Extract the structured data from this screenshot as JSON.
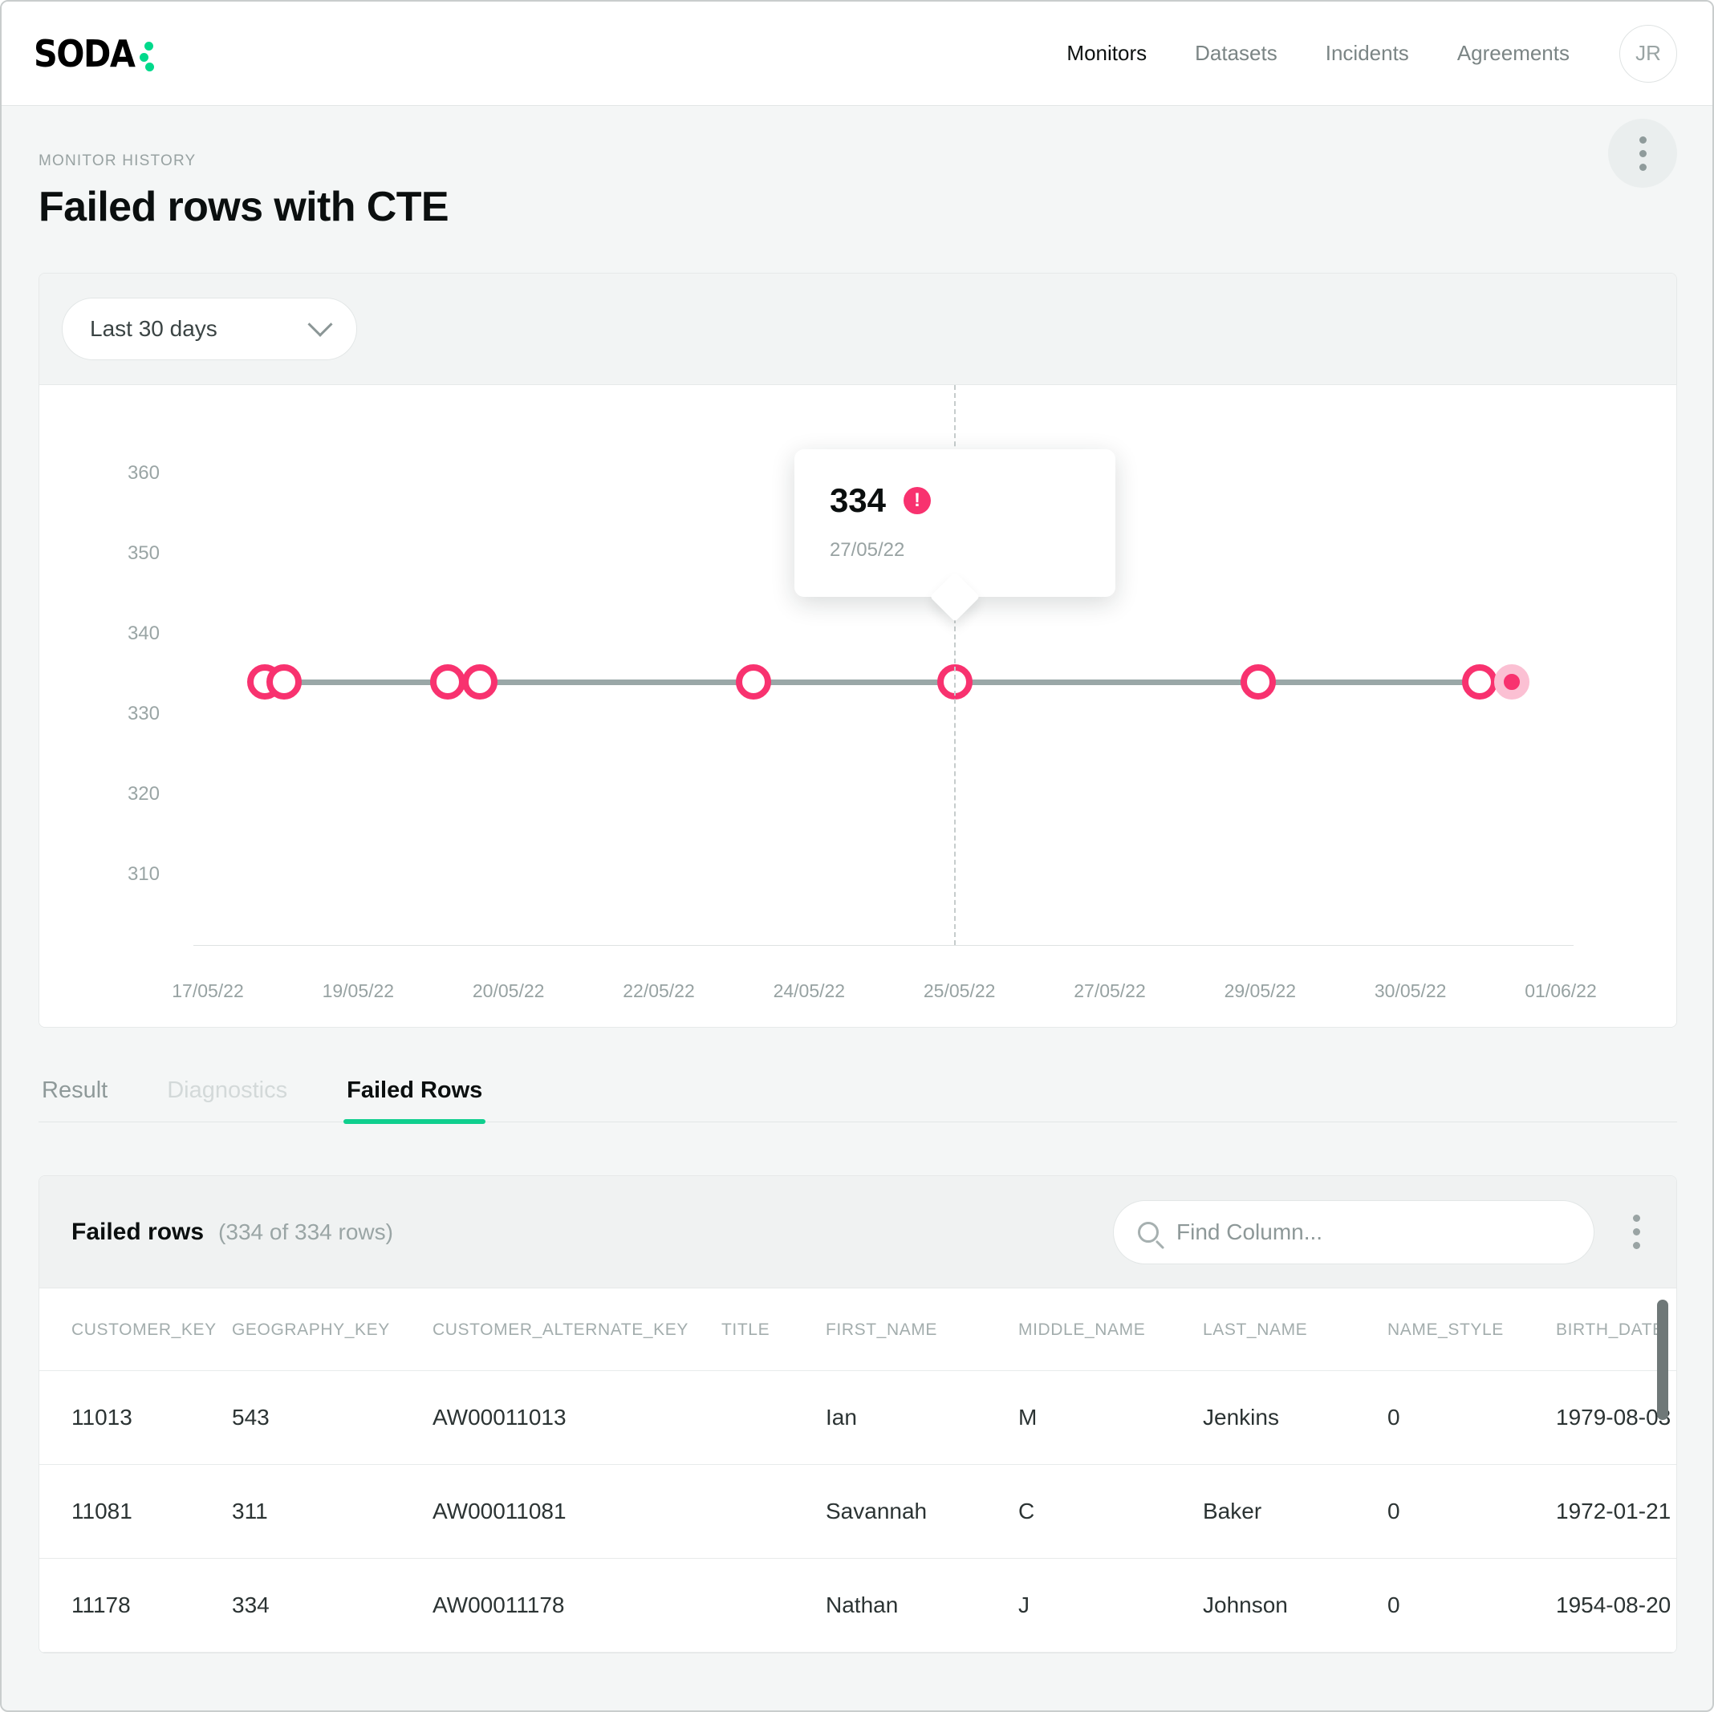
{
  "nav": {
    "logo_text": "SODA",
    "links": [
      {
        "label": "Monitors",
        "active": true
      },
      {
        "label": "Datasets",
        "active": false
      },
      {
        "label": "Incidents",
        "active": false
      },
      {
        "label": "Agreements",
        "active": false
      }
    ],
    "avatar_initials": "JR"
  },
  "page": {
    "eyebrow": "MONITOR HISTORY",
    "title": "Failed rows with CTE"
  },
  "chart_card": {
    "range_label": "Last 30 days"
  },
  "chart_data": {
    "type": "line",
    "title": "",
    "xlabel": "",
    "ylabel": "",
    "ylim": [
      305,
      365
    ],
    "yticks": [
      360,
      350,
      340,
      330,
      320,
      310
    ],
    "xticks": [
      "17/05/22",
      "19/05/22",
      "20/05/22",
      "22/05/22",
      "24/05/22",
      "25/05/22",
      "27/05/22",
      "29/05/22",
      "30/05/22",
      "01/06/22"
    ],
    "grid": false,
    "legend": "none",
    "series": [
      {
        "name": "Failed rows",
        "color": "#f8326f",
        "line_color": "#9aa7a7",
        "points": [
          {
            "x": "17/05/22",
            "y": 334,
            "style": "ring"
          },
          {
            "x": "18/05/22",
            "y": 334,
            "style": "ring"
          },
          {
            "x": "19/05/22",
            "y": 334,
            "style": "ring"
          },
          {
            "x": "20/05/22",
            "y": 334,
            "style": "ring"
          },
          {
            "x": "24/05/22",
            "y": 334,
            "style": "ring"
          },
          {
            "x": "27/05/22",
            "y": 334,
            "style": "ring"
          },
          {
            "x": "30/05/22",
            "y": 334,
            "style": "ring"
          },
          {
            "x": "01/06/22",
            "y": 334,
            "style": "ring"
          },
          {
            "x": "02/06/22",
            "y": 334,
            "style": "filled"
          }
        ]
      }
    ],
    "tooltip": {
      "value": "334",
      "badge": "!",
      "date": "27/05/22"
    }
  },
  "tabs": [
    {
      "label": "Result",
      "state": "normal"
    },
    {
      "label": "Diagnostics",
      "state": "disabled"
    },
    {
      "label": "Failed Rows",
      "state": "active"
    }
  ],
  "table": {
    "title": "Failed rows",
    "count_label": "(334 of 334 rows)",
    "search_placeholder": "Find Column...",
    "columns": [
      "CUSTOMER_KEY",
      "GEOGRAPHY_KEY",
      "CUSTOMER_ALTERNATE_KEY",
      "TITLE",
      "FIRST_NAME",
      "MIDDLE_NAME",
      "LAST_NAME",
      "NAME_STYLE",
      "BIRTH_DATE"
    ],
    "rows": [
      [
        "11013",
        "543",
        "AW00011013",
        "",
        "Ian",
        "M",
        "Jenkins",
        "0",
        "1979-08-03"
      ],
      [
        "11081",
        "311",
        "AW00011081",
        "",
        "Savannah",
        "C",
        "Baker",
        "0",
        "1972-01-21"
      ],
      [
        "11178",
        "334",
        "AW00011178",
        "",
        "Nathan",
        "J",
        "Johnson",
        "0",
        "1954-08-20"
      ]
    ]
  },
  "colors": {
    "accent_green": "#0fcf8e",
    "accent_pink": "#f8326f",
    "text_dark": "#0b0f0f",
    "text_muted": "#98a2a2",
    "page_bg": "#f4f6f6"
  }
}
